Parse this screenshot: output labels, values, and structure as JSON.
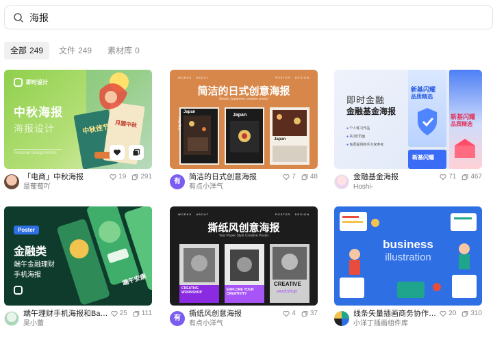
{
  "search": {
    "value": "海报",
    "placeholder": ""
  },
  "tabs": [
    {
      "label": "全部",
      "count": "249"
    },
    {
      "label": "文件",
      "count": "249"
    },
    {
      "label": "素材库",
      "count": "0"
    }
  ],
  "cards": [
    {
      "title": "「电商」中秋海报",
      "author": "是葡萄吖",
      "likes": "19",
      "views": "291",
      "thumb": {
        "brand": "即时设计",
        "heading": "中秋海报",
        "subheading": "海报设计",
        "tagline": "Personal Design Works",
        "poster_text": "中秋佳节",
        "poster_text2": "月圆中秋"
      }
    },
    {
      "title": "简洁的日式创意海报",
      "author": "有点小洋气",
      "likes": "7",
      "views": "48",
      "avatar_text": "有",
      "thumb": {
        "nav": [
          "WORKS",
          "ABOUT",
          "POSTER",
          "DESIGN"
        ],
        "heading": "简洁的日式创意海报",
        "subheading": "Simple Japanese creative poster",
        "poster_labels": [
          "Japan",
          "Japan",
          "Japan"
        ],
        "side_label": "City Tour"
      }
    },
    {
      "title": "金融基金海报",
      "author": "Hoshi-",
      "likes": "71",
      "views": "467",
      "thumb": {
        "heading1": "即时金融",
        "heading2": "金融基金海报",
        "bullets": [
          "个人练习作品",
          "共3张页面",
          "免费提供新手大家参考"
        ],
        "poster_heading": "新基闪耀",
        "poster_sub": "品质精选",
        "poster_heading2": "新基闪耀",
        "poster_sub2": "品质精选",
        "poster_heading3": "新基闪耀"
      }
    },
    {
      "title": "端午理财手机海报和Bann...",
      "author": "吴小蕾",
      "likes": "25",
      "views": "111",
      "thumb": {
        "badge": "Poster",
        "heading": "金融类",
        "line1": "端午金融理财",
        "line2": "手机海报",
        "poster_text": "端午安康"
      }
    },
    {
      "title": "撕纸风创意海报",
      "author": "有点小洋气",
      "likes": "4",
      "views": "37",
      "avatar_text": "有",
      "thumb": {
        "nav": [
          "WORKS",
          "ABOUT",
          "POSTER",
          "DESIGN"
        ],
        "heading": "撕纸风创意海报",
        "subheading": "Tear Paper Style Creative Poster",
        "p1": "CREATIVE WORKSHOP",
        "p2": "EXPLORE YOUR CREATIVITY",
        "p3": "CREATIVE",
        "p4": "workshop"
      }
    },
    {
      "title": "线条矢量插画商务协作问...",
      "author": "小洋丁插画组件库",
      "likes": "20",
      "views": "310",
      "thumb": {
        "heading": "business",
        "subheading": "illustration"
      }
    }
  ],
  "colors": {
    "accent": "#7b5cf0",
    "muted": "#8a8a8a",
    "tab_active_bg": "#f0f0f0"
  }
}
